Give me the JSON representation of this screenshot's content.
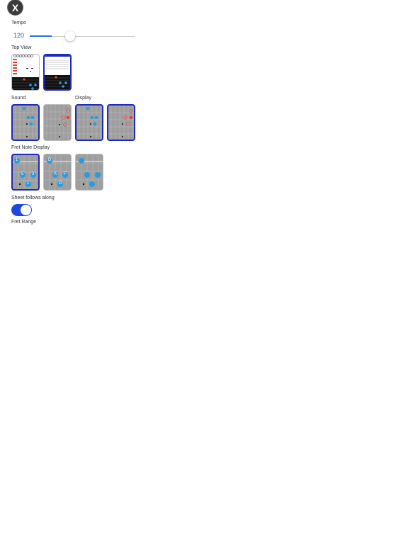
{
  "close": {
    "glyph": "X"
  },
  "tempo": {
    "label": "Tempo",
    "value": "120",
    "fraction": 0.41
  },
  "top_view": {
    "label": "Top View"
  },
  "sound": {
    "label": "Sound"
  },
  "display": {
    "label": "Display"
  },
  "fret_note_display": {
    "label": "Fret Note Display",
    "opt1": {
      "a": "1",
      "b": "5",
      "c": "3",
      "d": "1"
    },
    "opt2": {
      "a": "D",
      "b": "A",
      "c": "F",
      "d": "D"
    }
  },
  "sheet_follows": {
    "label": "Sheet follows along",
    "on": true
  },
  "fret_range": {
    "label": "Fret Range"
  },
  "mini": {
    "n1": "1",
    "n2": "3",
    "n3": "2",
    "n4": "5"
  },
  "colors": {
    "accent": "#1f48e0",
    "selected_border": "#1e2bb8",
    "note_blue": "#2a9be0",
    "note_red": "#e2443a"
  }
}
